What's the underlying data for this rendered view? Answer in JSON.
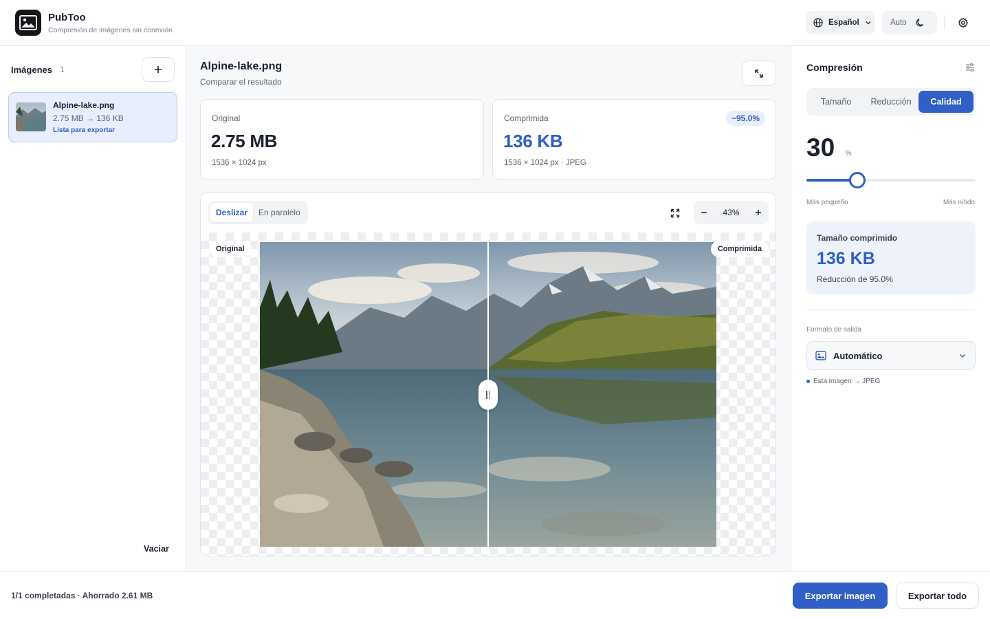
{
  "app": {
    "name": "PubToo",
    "subtitle": "Compresión de imágenes sin conexión",
    "language": "Español",
    "theme": "Auto",
    "icons": {
      "logo": "image-icon",
      "language": "globe-icon",
      "theme": "moon-icon",
      "settings": "gear-icon"
    }
  },
  "sidebar": {
    "title": "Imágenes",
    "count": "1",
    "clear_label": "Vaciar",
    "items": [
      {
        "name": "Alpine-lake.png",
        "sizes": "2.75 MB → 136 KB",
        "status": "Lista para exportar"
      }
    ]
  },
  "main": {
    "title": "Alpine-lake.png",
    "subtitle": "Comparar el resultado",
    "original": {
      "label": "Original",
      "size": "2.75 MB",
      "meta": "1536 × 1024 px"
    },
    "compressed": {
      "label": "Comprimida",
      "size": "136 KB",
      "meta": "1536 × 1024 px · JPEG",
      "badge": "−95.0%"
    },
    "viewer": {
      "modes": [
        "Deslizar",
        "En paralelo"
      ],
      "active_mode": "Deslizar",
      "zoom": "43%",
      "label_left": "Original",
      "label_right": "Comprimida",
      "slider_position": 0.5
    }
  },
  "panel": {
    "title": "Compresión",
    "tabs": [
      "Tamaño",
      "Reducción",
      "Calidad"
    ],
    "active_tab": "Calidad",
    "quality_value": "30",
    "quality_unit": "%",
    "quality_fraction": 0.3,
    "slider_min_label": "Más pequeño",
    "slider_max_label": "Más nítido",
    "result": {
      "label": "Tamaño comprimido",
      "value": "136 KB",
      "reduction": "Reducción de 95.0%"
    },
    "format": {
      "label": "Formato de salida",
      "value": "Automático",
      "note": "Esta imagen → JPEG"
    }
  },
  "footer": {
    "status": "1/1 completadas · Ahorrado 2.61 MB",
    "export_image": "Exportar imagen",
    "export_all": "Exportar todo"
  },
  "colors": {
    "accent": "#2f5fc7",
    "accent_soft": "#e8eefb",
    "text": "#1c2130",
    "muted": "#5b616c"
  }
}
